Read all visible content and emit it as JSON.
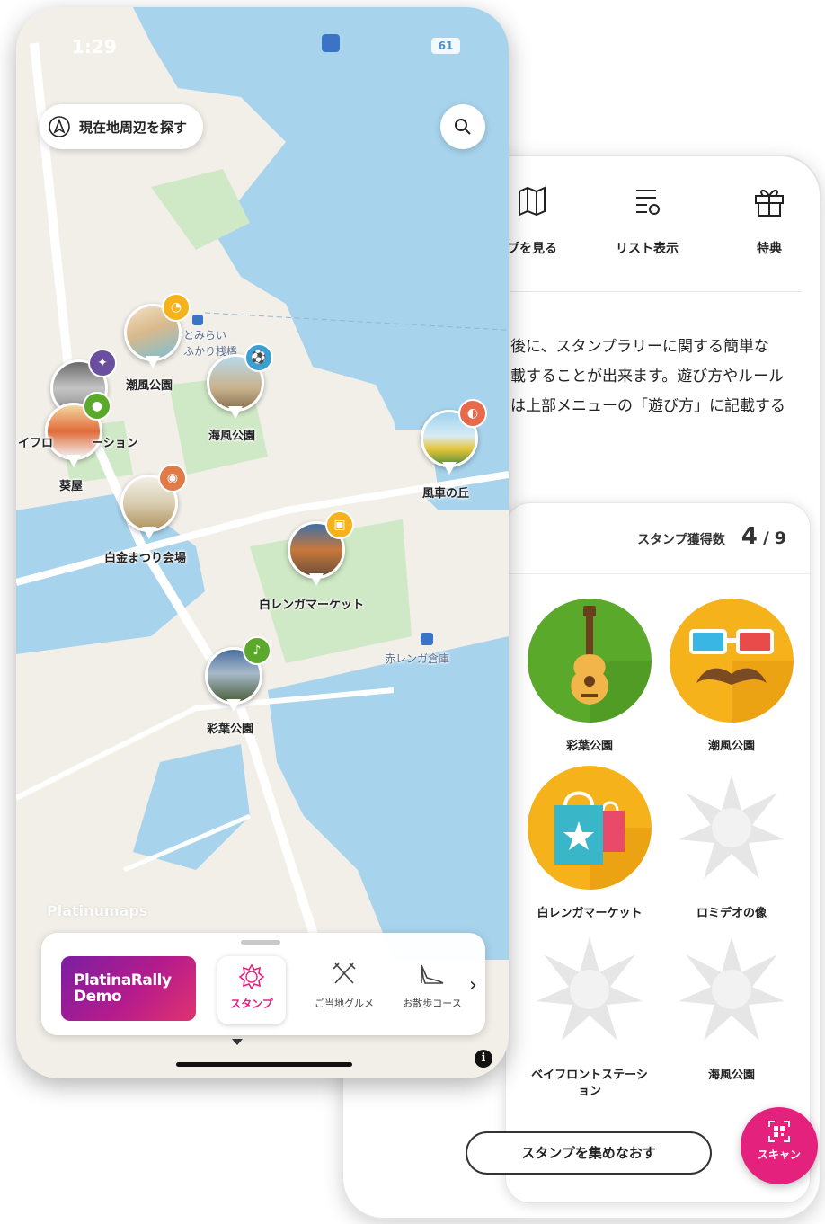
{
  "colors": {
    "accent": "#e5217e",
    "water": "#a7d3ec",
    "land": "#f2efe9",
    "park": "#cfe8c6"
  },
  "stamp_panel": {
    "menu": [
      {
        "icon": "map-icon",
        "label": "プを見る"
      },
      {
        "icon": "list-icon",
        "label": "リスト表示"
      },
      {
        "icon": "gift-icon",
        "label": "特典"
      }
    ],
    "description_lines": [
      "後に、スタンプラリーに関する簡単な",
      "載することが出来ます。遊び方やルール",
      "は上部メニューの「遊び方」に記載する"
    ],
    "count_label": "スタンプ獲得数",
    "count_value": "4",
    "count_sep": "/",
    "count_total": "9",
    "stamps": [
      {
        "name": "彩葉公園",
        "icon": "guitar-icon",
        "collected": true
      },
      {
        "name": "潮風公園",
        "icon": "mustache-glasses-icon",
        "collected": true
      },
      {
        "name": "白レンガマーケット",
        "icon": "shopping-bag-icon",
        "collected": true
      },
      {
        "name": "ロミデオの像",
        "icon": "placeholder-star-icon",
        "collected": false
      },
      {
        "name": "ベイフロントステーション",
        "icon": "placeholder-star-icon",
        "collected": false
      },
      {
        "name": "海風公園",
        "icon": "placeholder-star-icon",
        "collected": false
      }
    ],
    "recollect_label": "スタンプを集めなおす",
    "scan_label": "スキャン"
  },
  "map": {
    "status_time": "1:29",
    "battery": "61",
    "nearby_label": "現在地周辺を探す",
    "pins": [
      {
        "label": "潮風公園",
        "badge_icon": "mustache-glasses-icon"
      },
      {
        "label": "海風公園",
        "badge_icon": "soccer-ball-icon"
      },
      {
        "label": "ーション",
        "badge_icon": "telescope-icon"
      },
      {
        "label": "葵屋",
        "badge_icon": "food-icon"
      },
      {
        "label": "白金まつり会場",
        "badge_icon": "drum-icon"
      },
      {
        "label": "風車の丘",
        "badge_icon": "glasses-icon"
      },
      {
        "label": "白レンガマーケット",
        "badge_icon": "shopping-bag-icon"
      },
      {
        "label": "彩葉公園",
        "badge_icon": "guitar-icon"
      }
    ],
    "label_fragment": "イフロ",
    "places": [
      "赤レンガ倉庫",
      "とみらい",
      "ふかり桟橋"
    ],
    "watermark": "Platinumaps",
    "brand": {
      "line1": "PlatinaRally",
      "line2": "Demo"
    },
    "tabs": [
      {
        "label": "スタンプ",
        "icon": "stamp-icon",
        "active": true
      },
      {
        "label": "ご当地グルメ",
        "icon": "fork-knife-icon",
        "active": false
      },
      {
        "label": "お散歩コース",
        "icon": "high-heel-icon",
        "active": false
      }
    ],
    "next_symbol": "›",
    "info_symbol": "i"
  }
}
